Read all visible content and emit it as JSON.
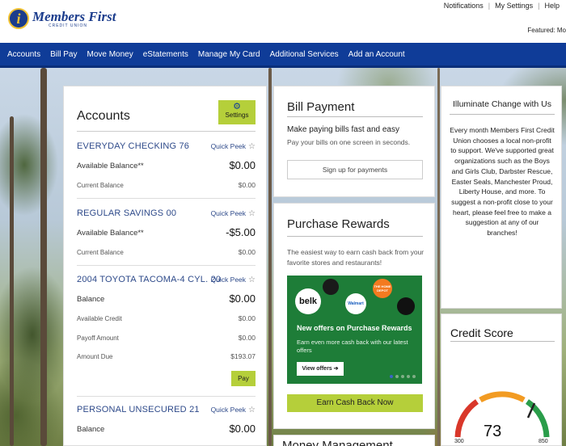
{
  "brand": {
    "name": "Members First",
    "tagline": "CREDIT UNION"
  },
  "toplinks": {
    "notifications": "Notifications",
    "settings": "My Settings",
    "help": "Help"
  },
  "featured": "Featured: Mo",
  "nav": [
    "Accounts",
    "Bill Pay",
    "Move Money",
    "eStatements",
    "Manage My Card",
    "Additional Services",
    "Add an Account"
  ],
  "accounts": {
    "title": "Accounts",
    "settings_label": "Settings",
    "quick_peek": "Quick Peek",
    "items": [
      {
        "name": "EVERYDAY CHECKING 76",
        "rows": [
          {
            "label": "Available Balance**",
            "value": "$0.00"
          },
          {
            "label": "Current Balance",
            "value": "$0.00"
          }
        ]
      },
      {
        "name": "REGULAR SAVINGS 00",
        "rows": [
          {
            "label": "Available Balance**",
            "value": "-$5.00"
          },
          {
            "label": "Current Balance",
            "value": "$0.00"
          }
        ]
      },
      {
        "name": "2004 TOYOTA TACOMA-4 CYL. 20",
        "rows": [
          {
            "label": "Balance",
            "value": "$0.00"
          },
          {
            "label": "Available Credit",
            "value": "$0.00"
          },
          {
            "label": "Payoff Amount",
            "value": "$0.00"
          },
          {
            "label": "Amount Due",
            "value": "$193.07"
          }
        ],
        "pay_label": "Pay"
      },
      {
        "name": "PERSONAL UNSECURED 21",
        "rows": [
          {
            "label": "Balance",
            "value": "$0.00"
          }
        ]
      }
    ]
  },
  "bill": {
    "title": "Bill Payment",
    "subtitle": "Make paying bills fast and easy",
    "desc": "Pay your bills on one screen in seconds.",
    "button": "Sign up for payments"
  },
  "rewards": {
    "title": "Purchase Rewards",
    "desc": "The easiest way to earn cash back from your favorite stores and restaurants!",
    "promo_head": "New offers on Purchase Rewards",
    "promo_body": "Earn even more cash back with our latest offers",
    "promo_button": "View offers",
    "brands": [
      "belk",
      "Walmart",
      "THE HOME DEPOT"
    ],
    "button": "Earn Cash Back Now"
  },
  "money": {
    "title": "Money Management"
  },
  "illuminate": {
    "title": "Illuminate Change with Us",
    "body": "Every month Members First Credit Union chooses a local non-profit to support. We've supported great organizations such as the Boys and Girls Club, Darbster Rescue, Easter Seals, Manchester Proud, Liberty House, and more. To suggest a non-profit close to your heart, please feel free to make a suggestion at any of our branches!"
  },
  "credit": {
    "title": "Credit Score",
    "score": "73",
    "min": "300",
    "max": "850",
    "colors": {
      "low": "#d9372a",
      "mid": "#f29b22",
      "high": "#2a9d4a"
    }
  },
  "theme": {
    "nav": "#0f3c98",
    "accent": "#b5cf3a",
    "link": "#2e4a8a"
  }
}
